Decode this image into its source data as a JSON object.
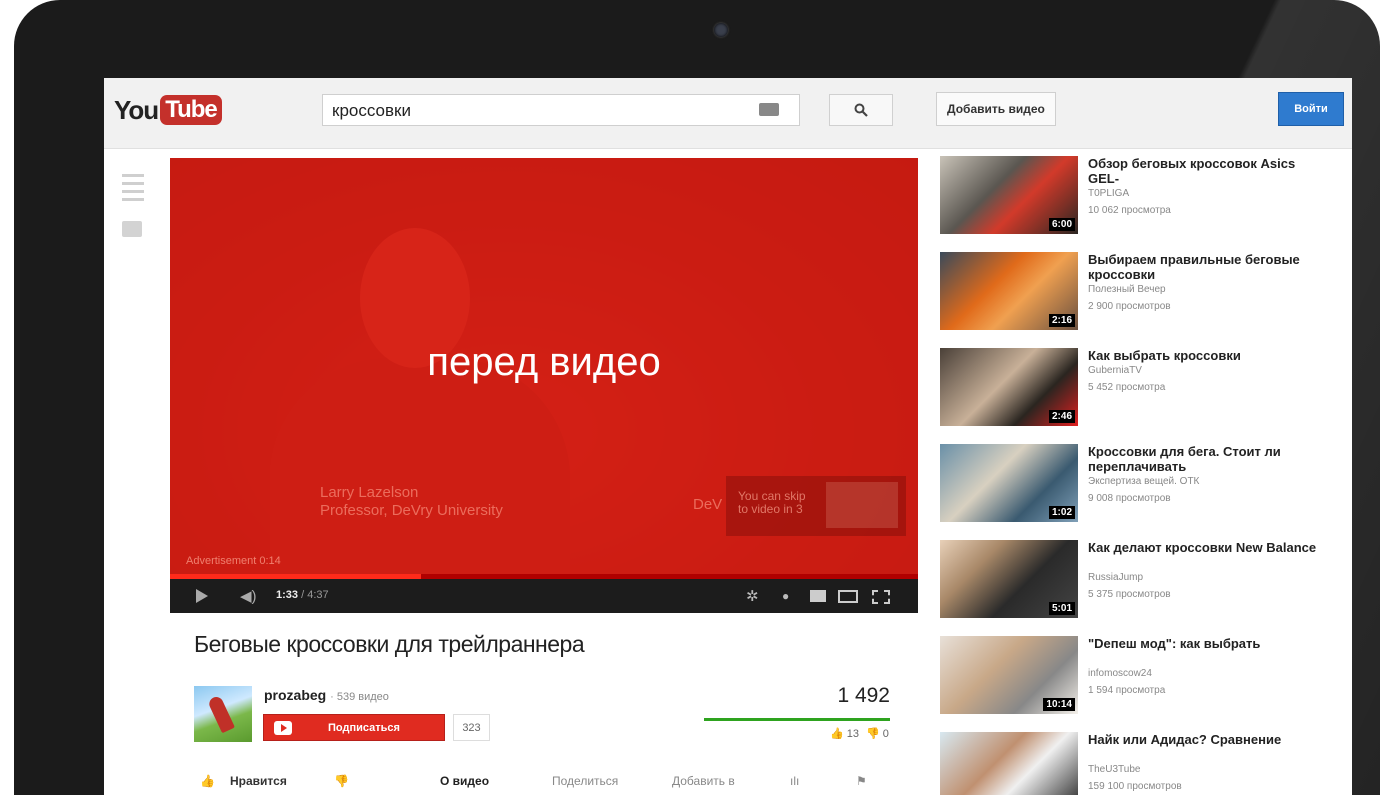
{
  "masthead": {
    "logo_you": "You",
    "logo_tube": "Tube",
    "search_value": "кроссовки",
    "upload_label": "Добавить видео",
    "signin_label": "Войти"
  },
  "player": {
    "overlay_text": "перед видео",
    "speaker_name": "Larry Lazelson",
    "speaker_title": "Professor, DeVry University",
    "brand_text": "DeV",
    "skip_line1": "You can skip",
    "skip_line2": "to video in 3",
    "ad_label": "Advertisement 0:14",
    "current_time": "1:33",
    "total_time": "/ 4:37",
    "progress_fraction": 0.336
  },
  "video": {
    "title": "Беговые кроссовки для трейлраннера",
    "channel_name": "prozabeg",
    "channel_count": "· 539 видео",
    "subscribe_label": "Подписаться",
    "subscriber_count": "323",
    "views": "1 492",
    "likes": "13",
    "dislikes": "0"
  },
  "actions": {
    "like": "Нравится",
    "about": "О видео",
    "share": "Поделиться",
    "add": "Добавить в"
  },
  "recommendations": [
    {
      "title": "Обзор беговых кроссовок Asics GEL-",
      "channel": "T0PLIGA",
      "views": "10 062 просмотра",
      "duration": "6:00"
    },
    {
      "title": "Выбираем правильные беговые кроссовки",
      "channel": "Полезный Вечер",
      "views": "2 900 просмотров",
      "duration": "2:16"
    },
    {
      "title": "Как выбрать кроссовки",
      "channel": "GuberniaTV",
      "views": "5 452 просмотра",
      "duration": "2:46"
    },
    {
      "title": "Кроссовки для бега. Стоит ли переплачивать",
      "channel": "Экспертиза вещей. ОТК",
      "views": "9 008 просмотров",
      "duration": "1:02"
    },
    {
      "title": "Как делают кроссовки New Balance",
      "channel": "RussiaJump",
      "views": "5 375 просмотров",
      "duration": "5:01"
    },
    {
      "title": "\"Dепеш мод\": как выбрать",
      "channel": "infomoscow24",
      "views": "1 594 просмотра",
      "duration": "10:14"
    },
    {
      "title": "Найк или Адидас? Сравнение",
      "channel": "TheU3Tube",
      "views": "159 100 просмотров",
      "duration": ""
    }
  ],
  "colors": {
    "brand_red": "#e02b20",
    "signin_blue": "#2f7bcf",
    "like_green": "#2ea31f"
  }
}
